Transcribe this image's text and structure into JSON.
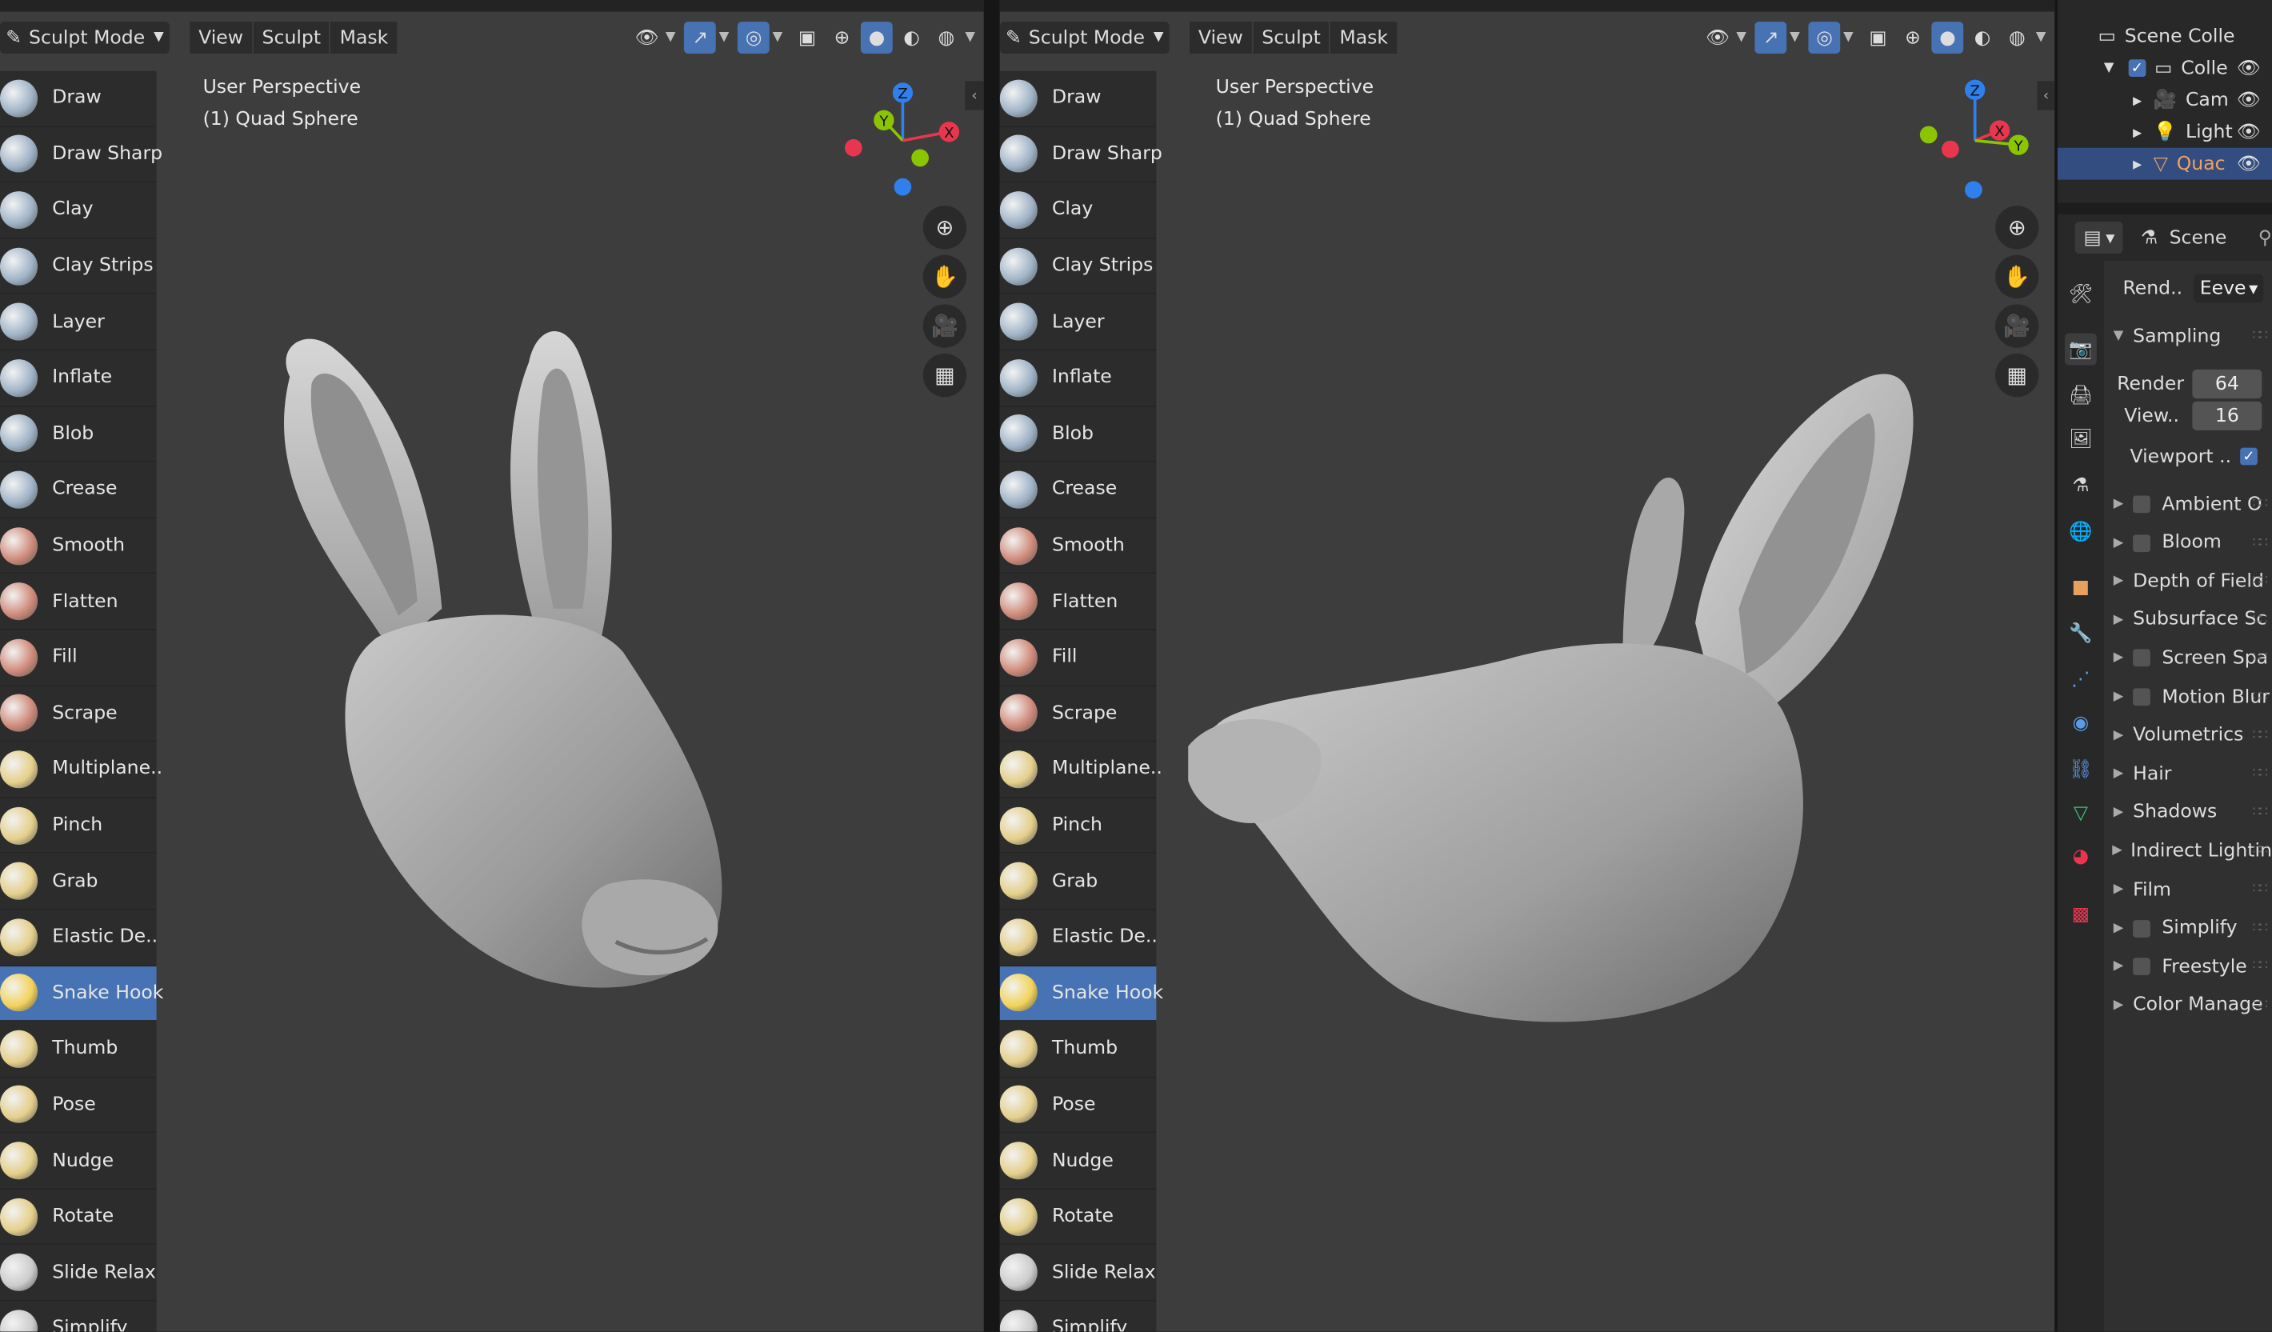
{
  "viewports": [
    {
      "mode_label": "Sculpt Mode",
      "menus": [
        "View",
        "Sculpt",
        "Mask"
      ],
      "perspective": "User Perspective",
      "object": "(1) Quad Sphere"
    },
    {
      "mode_label": "Sculpt Mode",
      "menus": [
        "View",
        "Sculpt",
        "Mask"
      ],
      "perspective": "User Perspective",
      "object": "(1) Quad Sphere"
    }
  ],
  "tools": [
    {
      "label": "Draw",
      "icon": "draw-brush-icon",
      "color": "#9fb3c8"
    },
    {
      "label": "Draw Sharp",
      "icon": "draw-sharp-brush-icon",
      "color": "#9fb3c8"
    },
    {
      "label": "Clay",
      "icon": "clay-brush-icon",
      "color": "#9fb3c8"
    },
    {
      "label": "Clay Strips",
      "icon": "clay-strips-brush-icon",
      "color": "#9fb3c8"
    },
    {
      "label": "Layer",
      "icon": "layer-brush-icon",
      "color": "#9fb3c8"
    },
    {
      "label": "Inflate",
      "icon": "inflate-brush-icon",
      "color": "#9fb3c8"
    },
    {
      "label": "Blob",
      "icon": "blob-brush-icon",
      "color": "#9fb3c8"
    },
    {
      "label": "Crease",
      "icon": "crease-brush-icon",
      "color": "#9fb3c8"
    },
    {
      "label": "Smooth",
      "icon": "smooth-brush-icon",
      "color": "#d08a7a"
    },
    {
      "label": "Flatten",
      "icon": "flatten-brush-icon",
      "color": "#d08a7a"
    },
    {
      "label": "Fill",
      "icon": "fill-brush-icon",
      "color": "#d08a7a"
    },
    {
      "label": "Scrape",
      "icon": "scrape-brush-icon",
      "color": "#d08a7a"
    },
    {
      "label": "Multiplane..",
      "icon": "multiplane-scrape-brush-icon",
      "color": "#e5cf8a"
    },
    {
      "label": "Pinch",
      "icon": "pinch-brush-icon",
      "color": "#e5cf8a"
    },
    {
      "label": "Grab",
      "icon": "grab-brush-icon",
      "color": "#e5cf8a"
    },
    {
      "label": "Elastic De..",
      "icon": "elastic-deform-brush-icon",
      "color": "#e5cf8a"
    },
    {
      "label": "Snake Hook",
      "icon": "snake-hook-brush-icon",
      "color": "#f2d35a",
      "active": true
    },
    {
      "label": "Thumb",
      "icon": "thumb-brush-icon",
      "color": "#e5cf8a"
    },
    {
      "label": "Pose",
      "icon": "pose-brush-icon",
      "color": "#e5cf8a"
    },
    {
      "label": "Nudge",
      "icon": "nudge-brush-icon",
      "color": "#e5cf8a"
    },
    {
      "label": "Rotate",
      "icon": "rotate-brush-icon",
      "color": "#e5cf8a"
    },
    {
      "label": "Slide Relax",
      "icon": "slide-relax-brush-icon",
      "color": "#cccccc"
    },
    {
      "label": "Simplify",
      "icon": "simplify-brush-icon",
      "color": "#cccccc"
    }
  ],
  "gizmo_labels": {
    "z": "Z",
    "y": "Y",
    "x": "X"
  },
  "outliner": {
    "scene_collection": "Scene Colle",
    "collection": "Colle",
    "camera": "Cam",
    "light": "Light",
    "object": "Quac"
  },
  "properties": {
    "scene_label": "Scene",
    "render_engine_label": "Rend..",
    "render_engine_value": "Eeve",
    "sampling": {
      "title": "Sampling",
      "render_label": "Render",
      "render_value": "64",
      "viewport_label": "View..",
      "viewport_value": "16",
      "denoise_label": "Viewport .."
    },
    "panels": [
      {
        "label": "Ambient O",
        "checkbox": true
      },
      {
        "label": "Bloom",
        "checkbox": true
      },
      {
        "label": "Depth of Field",
        "checkbox": false
      },
      {
        "label": "Subsurface Sc",
        "checkbox": false
      },
      {
        "label": "Screen Spa",
        "checkbox": true
      },
      {
        "label": "Motion Blur",
        "checkbox": true
      },
      {
        "label": "Volumetrics",
        "checkbox": false
      },
      {
        "label": "Hair",
        "checkbox": false
      },
      {
        "label": "Shadows",
        "checkbox": false
      },
      {
        "label": "Indirect Lightin",
        "checkbox": false
      },
      {
        "label": "Film",
        "checkbox": false
      },
      {
        "label": "Simplify",
        "checkbox": true
      },
      {
        "label": "Freestyle",
        "checkbox": true
      },
      {
        "label": "Color Manage",
        "checkbox": false
      }
    ]
  },
  "colors": {
    "accent": "#4772b3",
    "viewport_bg": "#3d3d3d",
    "panel_bg": "#2c2c2c",
    "axis_x": "#e8364f",
    "axis_y": "#8bc500",
    "axis_z": "#2f80ed"
  }
}
